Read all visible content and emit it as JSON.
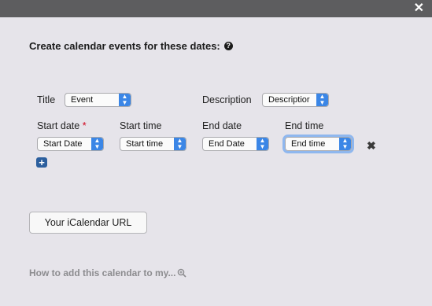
{
  "dialog": {
    "close_glyph": "✕",
    "heading": "Create calendar events for these dates:",
    "help_icon": "question-circle-icon"
  },
  "fields": {
    "title_label": "Title",
    "title_value": "Event",
    "description_label": "Description",
    "description_value": "Descriptior",
    "start_date_label": "Start date",
    "required_mark": "*",
    "start_date_value": "Start Date",
    "start_time_label": "Start time",
    "start_time_value": "Start time",
    "end_date_label": "End date",
    "end_date_value": "End Date",
    "end_time_label": "End time",
    "end_time_value": "End time"
  },
  "row_actions": {
    "remove_glyph": "✖",
    "add_glyph": "+"
  },
  "ical_button": "Your iCalendar URL",
  "howto_link": "How to add this calendar to my...",
  "colors": {
    "background": "#e6e4ea",
    "topbar": "#5d5d5f",
    "select_arrow": "#3b86e6",
    "add_button": "#2c5f9e",
    "required": "#d0021b"
  }
}
